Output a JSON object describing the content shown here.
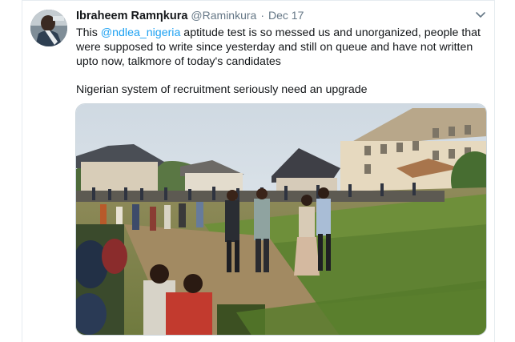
{
  "tweet": {
    "display_name": "Ibraheem Ramηkura",
    "handle": "@Raminkura",
    "separator": "·",
    "date": "Dec 17",
    "text": {
      "line1_prefix": "This ",
      "mention": "@ndlea_nigeria",
      "line1_suffix": " aptitude test is so messed us and unorganized, people that",
      "line2": "were supposed to write since yesterday and still on queue and have not written",
      "line3": "upto now, talkmore of today's candidates",
      "paragraph2": "Nigerian system of recruitment seriously need an upgrade"
    },
    "icons": {
      "avatar": "profile-photo",
      "menu": "chevron-down-icon"
    },
    "colors": {
      "link": "#1da1f2",
      "secondary_text": "#657786",
      "border": "#e6ecf0"
    }
  }
}
